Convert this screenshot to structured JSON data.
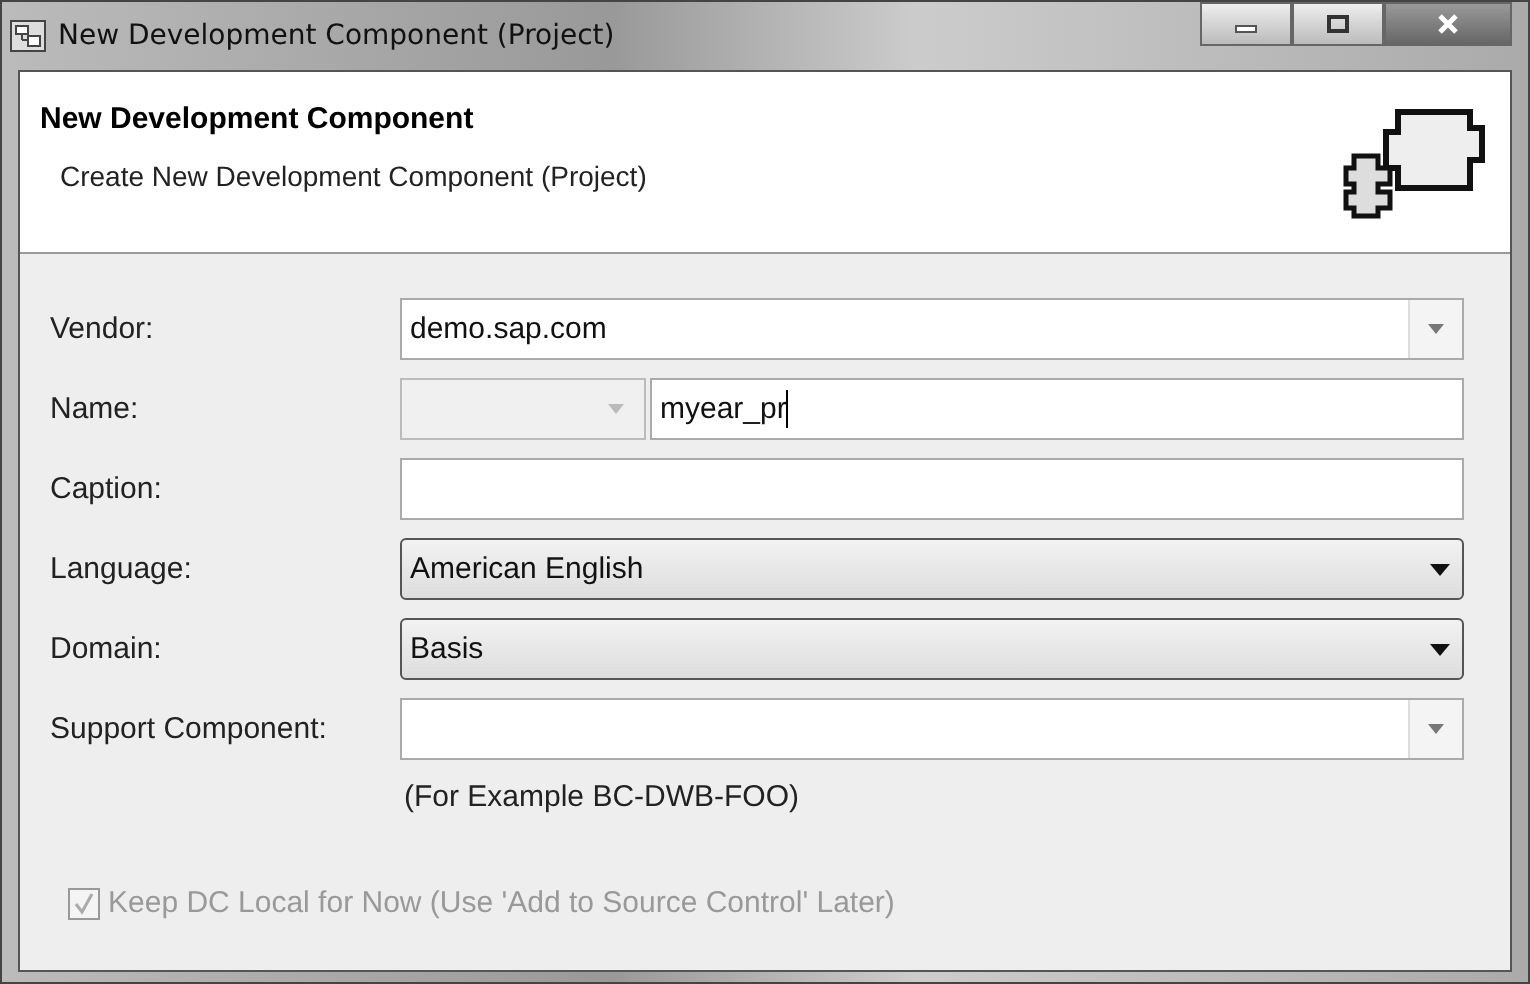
{
  "window": {
    "title": "New Development Component (Project)"
  },
  "header": {
    "title": "New Development Component",
    "subtitle": "Create New Development Component (Project)"
  },
  "fields": [
    {
      "label": "Vendor:",
      "kind": "combo",
      "value": "demo.sap.com"
    },
    {
      "label": "Name:",
      "kind": "prefixed",
      "prefix": {
        "disabled": true
      },
      "value": "myear_pr"
    },
    {
      "label": "Caption:",
      "kind": "text"
    },
    {
      "label": "Language:",
      "kind": "dropdown",
      "value": "American English"
    },
    {
      "label": "Domain:",
      "kind": "dropdown",
      "value": "Basis"
    },
    {
      "label": "Support Component:",
      "kind": "combo",
      "hint": "(For Example BC-DWB-FOO)"
    }
  ],
  "checkbox": {
    "label": "Keep DC Local for Now (Use 'Add to Source Control' Later)",
    "checked": true,
    "disabled": true
  }
}
